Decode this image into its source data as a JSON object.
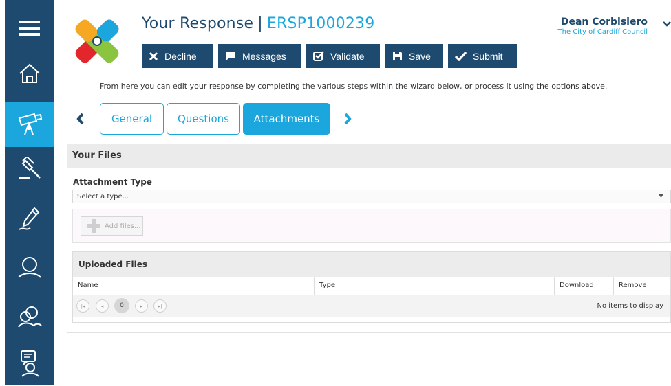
{
  "sidebar": {
    "items": [
      {
        "icon": "menu-icon"
      },
      {
        "icon": "home-icon"
      },
      {
        "icon": "telescope-icon",
        "active": true
      },
      {
        "icon": "gavel-icon"
      },
      {
        "icon": "pen-icon"
      },
      {
        "icon": "user-icon"
      },
      {
        "icon": "users-icon"
      },
      {
        "icon": "chat-user-icon"
      }
    ]
  },
  "header": {
    "title": "Your Response",
    "separator": "|",
    "reference": "ERSP1000239",
    "buttons": {
      "decline": "Decline",
      "messages": "Messages",
      "validate": "Validate",
      "save": "Save",
      "submit": "Submit"
    }
  },
  "user": {
    "name": "Dean Corbisiero",
    "organisation": "The City of Cardiff Council"
  },
  "hint": "From here you can edit your response by completing the various steps within the wizard below, or process it using the options above.",
  "wizard": {
    "tabs": [
      {
        "label": "General",
        "active": false
      },
      {
        "label": "Questions",
        "active": false
      },
      {
        "label": "Attachments",
        "active": true
      }
    ]
  },
  "files": {
    "section_title": "Your Files",
    "attachment_type_label": "Attachment Type",
    "select_placeholder": "Select a type...",
    "add_files_label": "Add files...",
    "uploaded": {
      "title": "Uploaded Files",
      "columns": [
        "Name",
        "Type",
        "Download",
        "Remove"
      ],
      "current_page": "0",
      "empty_text": "No items to display"
    }
  },
  "colors": {
    "navy": "#1d4a6e",
    "accent": "#1ba6dd"
  }
}
